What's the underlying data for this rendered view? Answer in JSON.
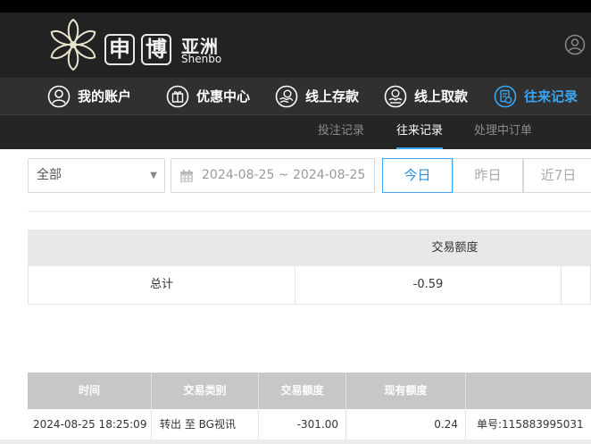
{
  "brand": {
    "box1": "申",
    "box2": "博",
    "cn": "亚洲",
    "en": "Shenbo"
  },
  "nav": [
    {
      "label": "我的账户",
      "icon": "user-circle-icon"
    },
    {
      "label": "优惠中心",
      "icon": "gift-icon"
    },
    {
      "label": "线上存款",
      "icon": "deposit-hand-icon"
    },
    {
      "label": "线上取款",
      "icon": "withdraw-hand-icon"
    },
    {
      "label": "往来记录",
      "icon": "records-icon",
      "active": true
    }
  ],
  "subnav": [
    {
      "label": "投注记录"
    },
    {
      "label": "往来记录",
      "active": true
    },
    {
      "label": "处理中订单"
    }
  ],
  "filters": {
    "type_select": "全部",
    "date_range": "2024-08-25 ~ 2024-08-25",
    "quick": [
      "今日",
      "昨日",
      "近7日"
    ]
  },
  "summary": {
    "header": "交易额度",
    "label": "总计",
    "value": "-0.59"
  },
  "table": {
    "headers": [
      "时间",
      "交易类别",
      "交易额度",
      "现有额度"
    ],
    "rows": [
      {
        "time": "2024-08-25 18:25:09",
        "category": "转出 至 BG视讯",
        "amount": "-301.00",
        "balance": "0.24",
        "note": "单号:115883995031"
      }
    ]
  },
  "colors": {
    "accent": "#3aa5f3",
    "header_bg": "#222222",
    "nav_bg": "#303030"
  }
}
